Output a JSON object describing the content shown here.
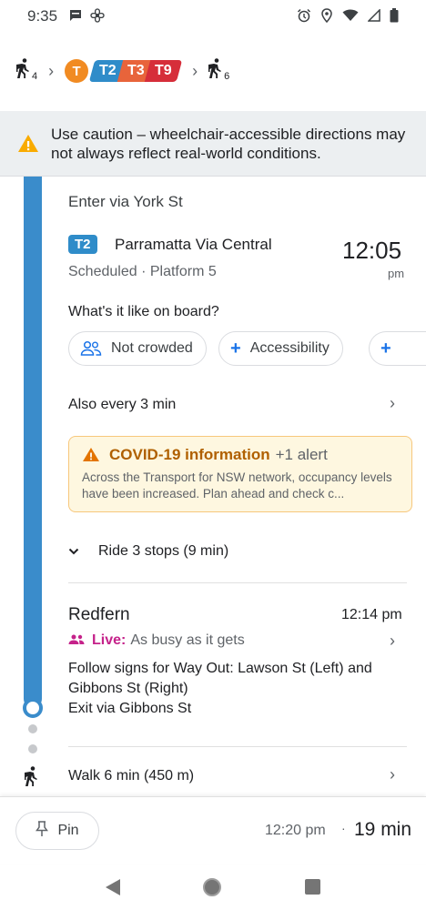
{
  "status_bar": {
    "time": "9:35",
    "left_icons": [
      "message-icon",
      "fan-icon"
    ],
    "right_icons": [
      "alarm-icon",
      "location-icon",
      "wifi-icon",
      "signal-icon",
      "battery-icon"
    ]
  },
  "route_summary": {
    "walk_start_minutes": "4",
    "mode_letter": "T",
    "lines": [
      {
        "label": "T2",
        "color": "#2f8cc9"
      },
      {
        "label": "T3",
        "color": "#e8643b"
      },
      {
        "label": "T9",
        "color": "#d62e3a"
      }
    ],
    "walk_end_minutes": "6"
  },
  "caution": {
    "text": "Use caution – wheelchair-accessible directions may not always reflect real-world conditions."
  },
  "trip": {
    "enter_via": "Enter via York St",
    "line_badge": "T2",
    "route_name": "Parramatta Via Central",
    "departure_time": "12:05",
    "departure_ampm": "pm",
    "status": "Scheduled · Platform 5",
    "onboard_question": "What's it like on board?",
    "chips": [
      {
        "label": "Not crowded",
        "icon": "people-icon"
      },
      {
        "label": "Accessibility",
        "icon": "plus-icon"
      },
      {
        "label": "",
        "icon": "plus-icon"
      }
    ],
    "frequency": "Also every 3 min",
    "covid": {
      "title": "COVID-19 information",
      "alerts": "+1 alert",
      "body": "Across the Transport for NSW network, occupancy levels have been increased. Plan ahead and check c..."
    },
    "ride_stops": "Ride 3 stops (9 min)"
  },
  "arrival": {
    "stop_name": "Redfern",
    "time": "12:14 pm",
    "live_label": "Live:",
    "busyness": "As busy as it gets",
    "instructions": "Follow signs for Way Out: Lawson St (Left) and Gibbons St (Right)",
    "exit": "Exit via Gibbons St"
  },
  "walk": {
    "text": "Walk 6 min (450 m)"
  },
  "bottom_bar": {
    "pin_label": "Pin",
    "arrive_time": "12:20 pm",
    "separator": "·",
    "duration": "19 min"
  },
  "colors": {
    "line_blue": "#3a8ccb",
    "caution_bg": "#eceff1",
    "warning_orange": "#f9ab00",
    "live_pink": "#c5228a",
    "covid_bg": "#fef7e0"
  }
}
